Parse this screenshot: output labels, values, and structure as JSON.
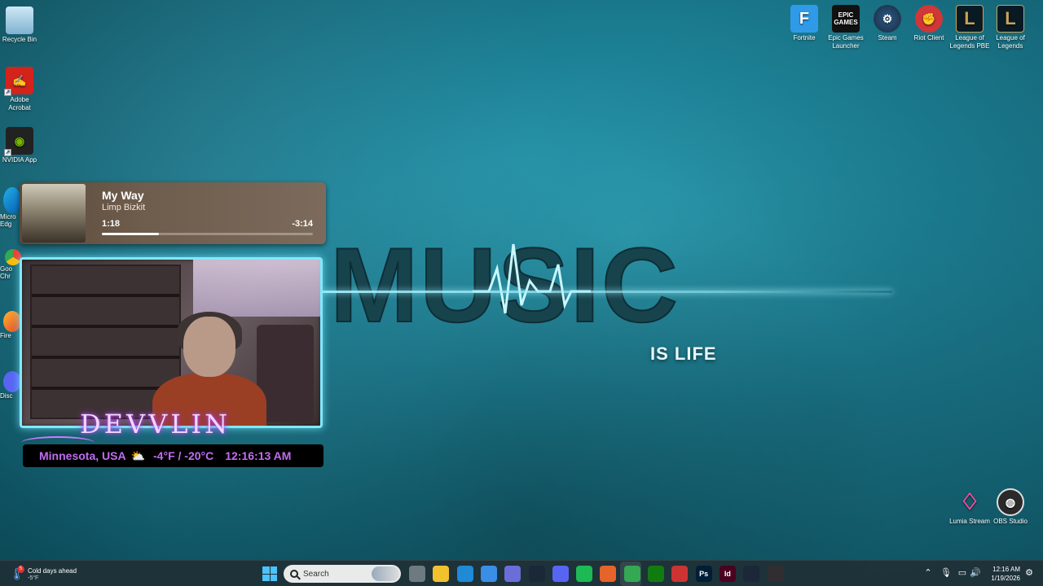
{
  "desktop": {
    "left_icons": [
      {
        "label": "Recycle Bin",
        "icon": "recycle-bin-icon"
      },
      {
        "label": "Adobe Acrobat",
        "icon": "adobe-acrobat-icon"
      },
      {
        "label": "NVIDIA App",
        "icon": "nvidia-icon"
      }
    ],
    "left_partial_icons": [
      {
        "label": "Micro Edg",
        "icon": "edge-icon"
      },
      {
        "label": "Goo Chr",
        "icon": "chrome-icon"
      },
      {
        "label": "Fire",
        "icon": "firefox-icon"
      },
      {
        "label": "Disc",
        "icon": "discord-icon"
      }
    ],
    "right_icons": [
      {
        "label": "Fortnite",
        "icon": "fortnite-icon",
        "glyph": "F",
        "color": "#2f9be8"
      },
      {
        "label": "Epic Games Launcher",
        "icon": "epic-games-icon",
        "glyph": "EPIC GAMES",
        "color": "#111111"
      },
      {
        "label": "Steam",
        "icon": "steam-icon",
        "glyph": "",
        "color": "#1b2838"
      },
      {
        "label": "Riot Client",
        "icon": "riot-client-icon",
        "glyph": "",
        "color": "#d13639"
      },
      {
        "label": "League of Legends PBE",
        "icon": "league-pbe-icon",
        "glyph": "L",
        "color": "#0a1a22"
      },
      {
        "label": "League of Legends",
        "icon": "league-icon",
        "glyph": "L",
        "color": "#0a1a22"
      }
    ],
    "bottom_right_icons": [
      {
        "label": "Lumia Stream",
        "icon": "lumia-stream-icon"
      },
      {
        "label": "OBS Studio",
        "icon": "obs-studio-icon"
      }
    ]
  },
  "wallpaper": {
    "headline": "MUSIC",
    "tagline": "IS LIFE"
  },
  "now_playing": {
    "title": "My Way",
    "artist": "Limp Bizkit",
    "elapsed": "1:18",
    "remaining": "-3:14",
    "progress_fraction": 0.27
  },
  "overlay": {
    "streamer_name": "DEVVLIN",
    "location": "Minnesota, USA",
    "weather_icon": "partly-cloudy-icon",
    "temperature": "-4°F / -20°C",
    "time": "12:16:13 AM"
  },
  "taskbar": {
    "weather_title": "Cold days ahead",
    "weather_temp": "-5°F",
    "weather_badge": "5",
    "search_placeholder": "Search",
    "apps": [
      {
        "name": "task-view-icon",
        "color": "#6d7a80",
        "glyph": ""
      },
      {
        "name": "file-explorer-icon",
        "color": "#f2c12e",
        "glyph": ""
      },
      {
        "name": "edge-icon",
        "color": "#1f8ad6",
        "glyph": ""
      },
      {
        "name": "microsoft-store-icon",
        "color": "#3a8ee6",
        "glyph": ""
      },
      {
        "name": "copilot-icon",
        "color": "#6b6dd9",
        "glyph": ""
      },
      {
        "name": "steam-icon",
        "color": "#1b2838",
        "glyph": ""
      },
      {
        "name": "discord-icon",
        "color": "#5865f2",
        "glyph": ""
      },
      {
        "name": "spotify-icon",
        "color": "#1db954",
        "glyph": ""
      },
      {
        "name": "firefox-icon",
        "color": "#e6632a",
        "glyph": ""
      },
      {
        "name": "chrome-icon",
        "color": "#34a853",
        "glyph": ""
      },
      {
        "name": "xbox-icon",
        "color": "#107c10",
        "glyph": ""
      },
      {
        "name": "snipping-tool-icon",
        "color": "#c33",
        "glyph": ""
      },
      {
        "name": "photoshop-icon",
        "color": "#001e36",
        "glyph": "Ps"
      },
      {
        "name": "indesign-icon",
        "color": "#49021f",
        "glyph": "Id"
      },
      {
        "name": "steam-tray-icon",
        "color": "#1b2838",
        "glyph": ""
      },
      {
        "name": "obs-icon",
        "color": "#302e31",
        "glyph": ""
      }
    ],
    "clock_time": "12:16 AM",
    "clock_date": "1/19/2026"
  }
}
